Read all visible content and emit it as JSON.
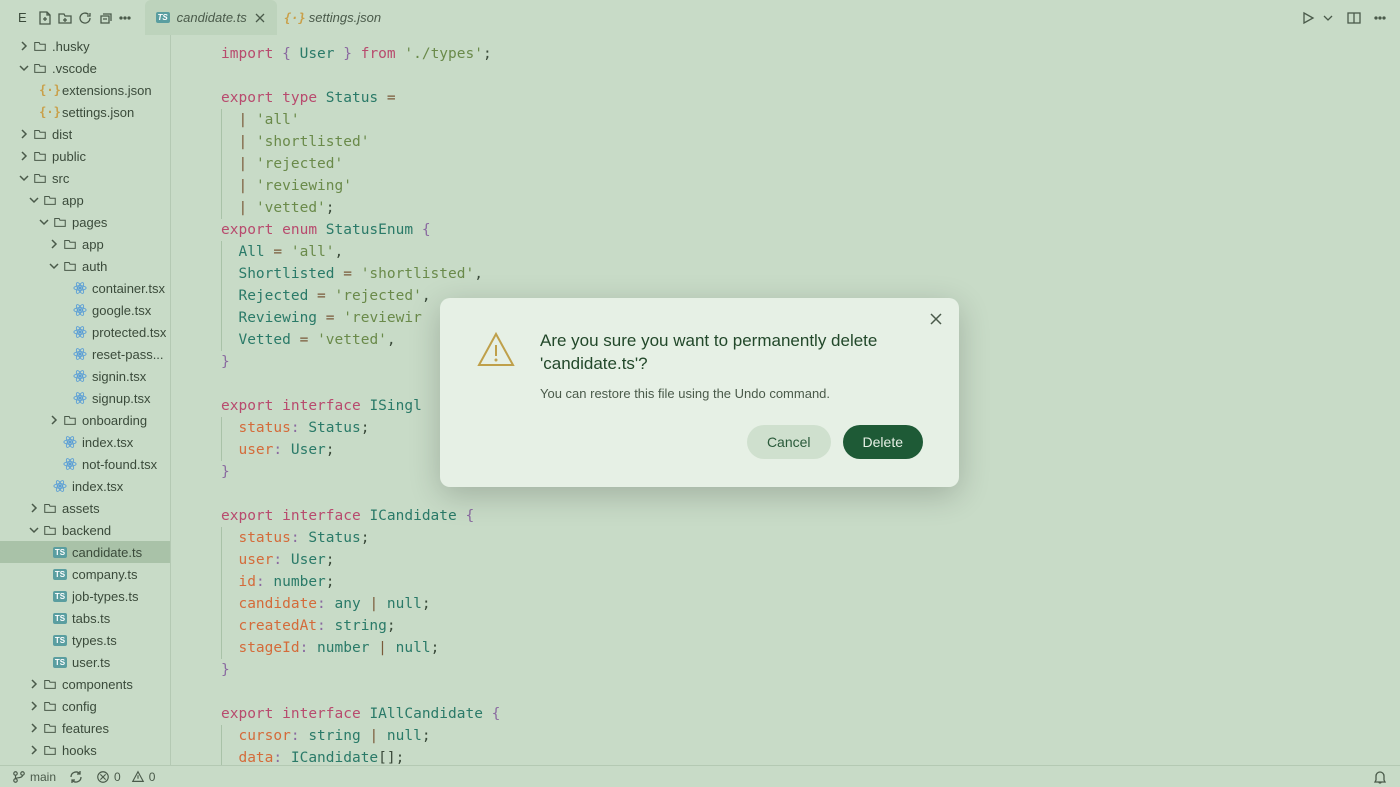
{
  "toolbar": {
    "explorer_letter": "E"
  },
  "tabs": [
    {
      "label": "candidate.ts",
      "icon": "ts",
      "active": true,
      "close": true
    },
    {
      "label": "settings.json",
      "icon": "json",
      "active": false,
      "close": false
    }
  ],
  "tree": [
    {
      "depth": 0,
      "chev": "right",
      "icon": "folder",
      "label": ".husky"
    },
    {
      "depth": 0,
      "chev": "down",
      "icon": "folder-vs",
      "label": ".vscode"
    },
    {
      "depth": 1,
      "chev": "",
      "icon": "json",
      "label": "extensions.json"
    },
    {
      "depth": 1,
      "chev": "",
      "icon": "json",
      "label": "settings.json"
    },
    {
      "depth": 0,
      "chev": "right",
      "icon": "folder",
      "label": "dist"
    },
    {
      "depth": 0,
      "chev": "right",
      "icon": "folder",
      "label": "public"
    },
    {
      "depth": 0,
      "chev": "down",
      "icon": "folder",
      "label": "src"
    },
    {
      "depth": 1,
      "chev": "down",
      "icon": "folder",
      "label": "app"
    },
    {
      "depth": 2,
      "chev": "down",
      "icon": "folder",
      "label": "pages"
    },
    {
      "depth": 3,
      "chev": "right",
      "icon": "folder",
      "label": "app"
    },
    {
      "depth": 3,
      "chev": "down",
      "icon": "folder",
      "label": "auth"
    },
    {
      "depth": 4,
      "chev": "",
      "icon": "react",
      "label": "container.tsx"
    },
    {
      "depth": 4,
      "chev": "",
      "icon": "react",
      "label": "google.tsx"
    },
    {
      "depth": 4,
      "chev": "",
      "icon": "react",
      "label": "protected.tsx"
    },
    {
      "depth": 4,
      "chev": "",
      "icon": "react",
      "label": "reset-pass..."
    },
    {
      "depth": 4,
      "chev": "",
      "icon": "react",
      "label": "signin.tsx"
    },
    {
      "depth": 4,
      "chev": "",
      "icon": "react",
      "label": "signup.tsx"
    },
    {
      "depth": 3,
      "chev": "right",
      "icon": "folder",
      "label": "onboarding"
    },
    {
      "depth": 3,
      "chev": "",
      "icon": "react",
      "label": "index.tsx"
    },
    {
      "depth": 3,
      "chev": "",
      "icon": "react",
      "label": "not-found.tsx"
    },
    {
      "depth": 2,
      "chev": "",
      "icon": "react",
      "label": "index.tsx"
    },
    {
      "depth": 1,
      "chev": "right",
      "icon": "folder",
      "label": "assets"
    },
    {
      "depth": 1,
      "chev": "down",
      "icon": "folder",
      "label": "backend"
    },
    {
      "depth": 2,
      "chev": "",
      "icon": "ts",
      "label": "candidate.ts",
      "selected": true
    },
    {
      "depth": 2,
      "chev": "",
      "icon": "ts",
      "label": "company.ts"
    },
    {
      "depth": 2,
      "chev": "",
      "icon": "ts",
      "label": "job-types.ts"
    },
    {
      "depth": 2,
      "chev": "",
      "icon": "ts",
      "label": "tabs.ts"
    },
    {
      "depth": 2,
      "chev": "",
      "icon": "ts",
      "label": "types.ts"
    },
    {
      "depth": 2,
      "chev": "",
      "icon": "ts",
      "label": "user.ts"
    },
    {
      "depth": 1,
      "chev": "right",
      "icon": "folder",
      "label": "components"
    },
    {
      "depth": 1,
      "chev": "right",
      "icon": "folder",
      "label": "config"
    },
    {
      "depth": 1,
      "chev": "right",
      "icon": "folder",
      "label": "features"
    },
    {
      "depth": 1,
      "chev": "right",
      "icon": "folder",
      "label": "hooks"
    }
  ],
  "code": [
    [
      [
        "kw",
        "import"
      ],
      [
        "p",
        " "
      ],
      [
        "punc",
        "{"
      ],
      [
        "p",
        " "
      ],
      [
        "type",
        "User"
      ],
      [
        "p",
        " "
      ],
      [
        "punc",
        "}"
      ],
      [
        "p",
        " "
      ],
      [
        "kw",
        "from"
      ],
      [
        "p",
        " "
      ],
      [
        "str",
        "'./types'"
      ],
      [
        "p",
        ";"
      ]
    ],
    [],
    [
      [
        "kw",
        "export"
      ],
      [
        "p",
        " "
      ],
      [
        "kw",
        "type"
      ],
      [
        "p",
        " "
      ],
      [
        "type",
        "Status"
      ],
      [
        "p",
        " "
      ],
      [
        "op",
        "="
      ]
    ],
    [
      [
        "p",
        "  "
      ],
      [
        "op",
        "|"
      ],
      [
        "p",
        " "
      ],
      [
        "str",
        "'all'"
      ]
    ],
    [
      [
        "p",
        "  "
      ],
      [
        "op",
        "|"
      ],
      [
        "p",
        " "
      ],
      [
        "str",
        "'shortlisted'"
      ]
    ],
    [
      [
        "p",
        "  "
      ],
      [
        "op",
        "|"
      ],
      [
        "p",
        " "
      ],
      [
        "str",
        "'rejected'"
      ]
    ],
    [
      [
        "p",
        "  "
      ],
      [
        "op",
        "|"
      ],
      [
        "p",
        " "
      ],
      [
        "str",
        "'reviewing'"
      ]
    ],
    [
      [
        "p",
        "  "
      ],
      [
        "op",
        "|"
      ],
      [
        "p",
        " "
      ],
      [
        "str",
        "'vetted'"
      ],
      [
        "p",
        ";"
      ]
    ],
    [
      [
        "kw",
        "export"
      ],
      [
        "p",
        " "
      ],
      [
        "kw",
        "enum"
      ],
      [
        "p",
        " "
      ],
      [
        "type",
        "StatusEnum"
      ],
      [
        "p",
        " "
      ],
      [
        "punc",
        "{"
      ]
    ],
    [
      [
        "p",
        "  "
      ],
      [
        "id",
        "All"
      ],
      [
        "p",
        " "
      ],
      [
        "op",
        "="
      ],
      [
        "p",
        " "
      ],
      [
        "str",
        "'all'"
      ],
      [
        "p",
        ","
      ]
    ],
    [
      [
        "p",
        "  "
      ],
      [
        "id",
        "Shortlisted"
      ],
      [
        "p",
        " "
      ],
      [
        "op",
        "="
      ],
      [
        "p",
        " "
      ],
      [
        "str",
        "'shortlisted'"
      ],
      [
        "p",
        ","
      ]
    ],
    [
      [
        "p",
        "  "
      ],
      [
        "id",
        "Rejected"
      ],
      [
        "p",
        " "
      ],
      [
        "op",
        "="
      ],
      [
        "p",
        " "
      ],
      [
        "str",
        "'rejected'"
      ],
      [
        "p",
        ","
      ]
    ],
    [
      [
        "p",
        "  "
      ],
      [
        "id",
        "Reviewing"
      ],
      [
        "p",
        " "
      ],
      [
        "op",
        "="
      ],
      [
        "p",
        " "
      ],
      [
        "str",
        "'reviewir"
      ]
    ],
    [
      [
        "p",
        "  "
      ],
      [
        "id",
        "Vetted"
      ],
      [
        "p",
        " "
      ],
      [
        "op",
        "="
      ],
      [
        "p",
        " "
      ],
      [
        "str",
        "'vetted'"
      ],
      [
        "p",
        ","
      ]
    ],
    [
      [
        "punc",
        "}"
      ]
    ],
    [],
    [
      [
        "kw",
        "export"
      ],
      [
        "p",
        " "
      ],
      [
        "kw",
        "interface"
      ],
      [
        "p",
        " "
      ],
      [
        "type",
        "ISingl"
      ]
    ],
    [
      [
        "p",
        "  "
      ],
      [
        "prop",
        "status"
      ],
      [
        "punc",
        ":"
      ],
      [
        "p",
        " "
      ],
      [
        "type",
        "Status"
      ],
      [
        "p",
        ";"
      ]
    ],
    [
      [
        "p",
        "  "
      ],
      [
        "prop",
        "user"
      ],
      [
        "punc",
        ":"
      ],
      [
        "p",
        " "
      ],
      [
        "type",
        "User"
      ],
      [
        "p",
        ";"
      ]
    ],
    [
      [
        "punc",
        "}"
      ]
    ],
    [],
    [
      [
        "kw",
        "export"
      ],
      [
        "p",
        " "
      ],
      [
        "kw",
        "interface"
      ],
      [
        "p",
        " "
      ],
      [
        "type",
        "ICandidate"
      ],
      [
        "p",
        " "
      ],
      [
        "punc",
        "{"
      ]
    ],
    [
      [
        "p",
        "  "
      ],
      [
        "prop",
        "status"
      ],
      [
        "punc",
        ":"
      ],
      [
        "p",
        " "
      ],
      [
        "type",
        "Status"
      ],
      [
        "p",
        ";"
      ]
    ],
    [
      [
        "p",
        "  "
      ],
      [
        "prop",
        "user"
      ],
      [
        "punc",
        ":"
      ],
      [
        "p",
        " "
      ],
      [
        "type",
        "User"
      ],
      [
        "p",
        ";"
      ]
    ],
    [
      [
        "p",
        "  "
      ],
      [
        "prop",
        "id"
      ],
      [
        "punc",
        ":"
      ],
      [
        "p",
        " "
      ],
      [
        "type",
        "number"
      ],
      [
        "p",
        ";"
      ]
    ],
    [
      [
        "p",
        "  "
      ],
      [
        "prop",
        "candidate"
      ],
      [
        "punc",
        ":"
      ],
      [
        "p",
        " "
      ],
      [
        "type",
        "any"
      ],
      [
        "p",
        " "
      ],
      [
        "op",
        "|"
      ],
      [
        "p",
        " "
      ],
      [
        "type",
        "null"
      ],
      [
        "p",
        ";"
      ]
    ],
    [
      [
        "p",
        "  "
      ],
      [
        "prop",
        "createdAt"
      ],
      [
        "punc",
        ":"
      ],
      [
        "p",
        " "
      ],
      [
        "type",
        "string"
      ],
      [
        "p",
        ";"
      ]
    ],
    [
      [
        "p",
        "  "
      ],
      [
        "prop",
        "stageId"
      ],
      [
        "punc",
        ":"
      ],
      [
        "p",
        " "
      ],
      [
        "type",
        "number"
      ],
      [
        "p",
        " "
      ],
      [
        "op",
        "|"
      ],
      [
        "p",
        " "
      ],
      [
        "type",
        "null"
      ],
      [
        "p",
        ";"
      ]
    ],
    [
      [
        "punc",
        "}"
      ]
    ],
    [],
    [
      [
        "kw",
        "export"
      ],
      [
        "p",
        " "
      ],
      [
        "kw",
        "interface"
      ],
      [
        "p",
        " "
      ],
      [
        "type",
        "IAllCandidate"
      ],
      [
        "p",
        " "
      ],
      [
        "punc",
        "{"
      ]
    ],
    [
      [
        "p",
        "  "
      ],
      [
        "prop",
        "cursor"
      ],
      [
        "punc",
        ":"
      ],
      [
        "p",
        " "
      ],
      [
        "type",
        "string"
      ],
      [
        "p",
        " "
      ],
      [
        "op",
        "|"
      ],
      [
        "p",
        " "
      ],
      [
        "type",
        "null"
      ],
      [
        "p",
        ";"
      ]
    ],
    [
      [
        "p",
        "  "
      ],
      [
        "prop",
        "data"
      ],
      [
        "punc",
        ":"
      ],
      [
        "p",
        " "
      ],
      [
        "type",
        "ICandidate"
      ],
      [
        "p",
        "[];"
      ]
    ]
  ],
  "status": {
    "branch": "main",
    "errors": "0",
    "warnings": "0"
  },
  "dialog": {
    "title": "Are you sure you want to permanently delete 'candidate.ts'?",
    "message": "You can restore this file using the Undo command.",
    "cancel": "Cancel",
    "delete": "Delete"
  }
}
